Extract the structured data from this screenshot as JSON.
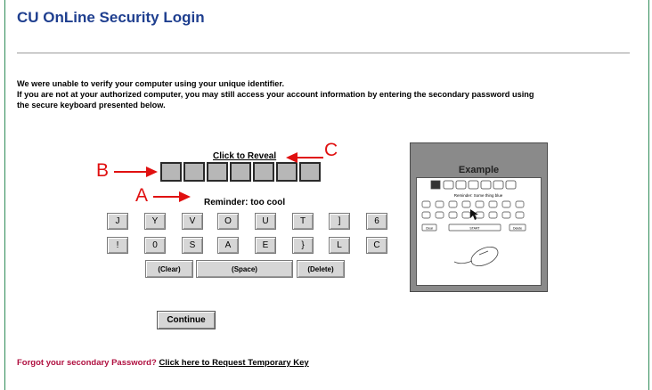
{
  "page": {
    "title": "CU OnLine Security Login",
    "message_line1": "We were unable to verify your computer using your unique identifier.",
    "message_line2": "If you are not at your authorized computer, you may still access your account information by entering the secondary password using",
    "message_line3": "the secure keyboard presented below."
  },
  "reveal": {
    "label": "Click to Reveal"
  },
  "reminder": {
    "text": "Reminder: too cool"
  },
  "annotations": {
    "a": "A",
    "b": "B",
    "c": "C",
    "color": "#e01010"
  },
  "keyboard": {
    "row1": [
      "J",
      "Y",
      "V",
      "O",
      "U",
      "T",
      "]",
      "6"
    ],
    "row2": [
      "!",
      "0",
      "S",
      "A",
      "E",
      "}",
      "L",
      "C"
    ],
    "clear_label": "(Clear)",
    "space_label": "(Space)",
    "delete_label": "(Delete)"
  },
  "continue_label": "Continue",
  "forgot": {
    "text": "Forgot your secondary Password?",
    "link": "Click here to Request Temporary Key"
  },
  "example": {
    "title": "Example",
    "reminder": "Reminder: Some thing blue",
    "start_label": "START",
    "clear_label": "Clear",
    "delete_label": "Delete"
  },
  "colors": {
    "title": "#1f3f8f",
    "forgot": "#b01040",
    "frame": "#2e8b57",
    "example_bg": "#8a8a8a"
  }
}
